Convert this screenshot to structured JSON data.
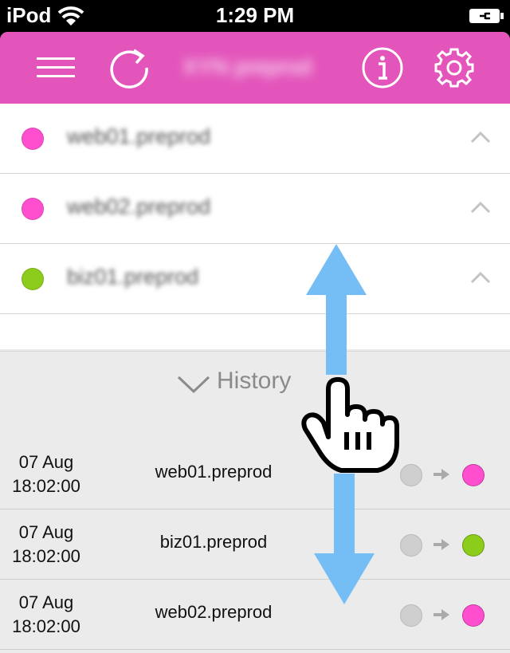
{
  "status": {
    "carrier": "iPod",
    "time": "1:29 PM"
  },
  "nav": {
    "title": "XYN preprod"
  },
  "colors": {
    "pink": "#ff4fcf",
    "green": "#8ccc1a",
    "gray": "#cfcfcf",
    "navbar": "#e355bb",
    "arrow": "#74bdf5"
  },
  "servers": [
    {
      "name": "web01.preprod",
      "status_color": "#ff4fcf"
    },
    {
      "name": "web02.preprod",
      "status_color": "#ff4fcf"
    },
    {
      "name": "biz01.preprod",
      "status_color": "#8ccc1a"
    }
  ],
  "history": {
    "label": "History",
    "entries": [
      {
        "date": "07 Aug",
        "time": "18:02:00",
        "name": "web01.preprod",
        "to_color": "#ff4fcf"
      },
      {
        "date": "07 Aug",
        "time": "18:02:00",
        "name": "biz01.preprod",
        "to_color": "#8ccc1a"
      },
      {
        "date": "07 Aug",
        "time": "18:02:00",
        "name": "web02.preprod",
        "to_color": "#ff4fcf"
      }
    ]
  }
}
